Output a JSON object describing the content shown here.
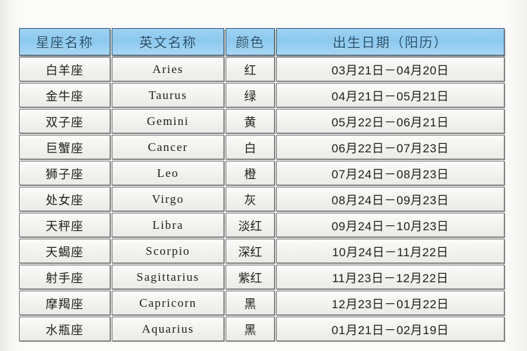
{
  "page": {
    "top_artifact_text": "· · · ·      · ·     · · · · ·",
    "background_color": "#fbfbf9",
    "header_color": "#8cc8ee",
    "header_text_color": "#20506e",
    "cell_color": "#f1f1ed",
    "border_color": "#6f7276"
  },
  "table": {
    "name": "zodiac-sign-table",
    "columns": [
      {
        "key": "name",
        "label": "星座名称"
      },
      {
        "key": "eng",
        "label": "英文名称"
      },
      {
        "key": "color",
        "label": "颜色"
      },
      {
        "key": "date",
        "label": "出生日期（阳历）"
      }
    ],
    "rows": [
      {
        "name": "白羊座",
        "eng": "Aries",
        "color": "红",
        "date": "03月21日－04月20日"
      },
      {
        "name": "金牛座",
        "eng": "Taurus",
        "color": "绿",
        "date": "04月21日－05月21日"
      },
      {
        "name": "双子座",
        "eng": "Gemini",
        "color": "黄",
        "date": "05月22日－06月21日"
      },
      {
        "name": "巨蟹座",
        "eng": "Cancer",
        "color": "白",
        "date": "06月22日－07月23日"
      },
      {
        "name": "狮子座",
        "eng": "Leo",
        "color": "橙",
        "date": "07月24日－08月23日"
      },
      {
        "name": "处女座",
        "eng": "Virgo",
        "color": "灰",
        "date": "08月24日－09月23日"
      },
      {
        "name": "天秤座",
        "eng": "Libra",
        "color": "淡红",
        "date": "09月24日－10月23日"
      },
      {
        "name": "天蝎座",
        "eng": "Scorpio",
        "color": "深红",
        "date": "10月24日－11月22日"
      },
      {
        "name": "射手座",
        "eng": "Sagittarius",
        "color": "紫红",
        "date": "11月23日－12月22日"
      },
      {
        "name": "摩羯座",
        "eng": "Capricorn",
        "color": "黑",
        "date": "12月23日－01月22日"
      },
      {
        "name": "水瓶座",
        "eng": "Aquarius",
        "color": "黑",
        "date": "01月21日－02月19日"
      }
    ]
  }
}
